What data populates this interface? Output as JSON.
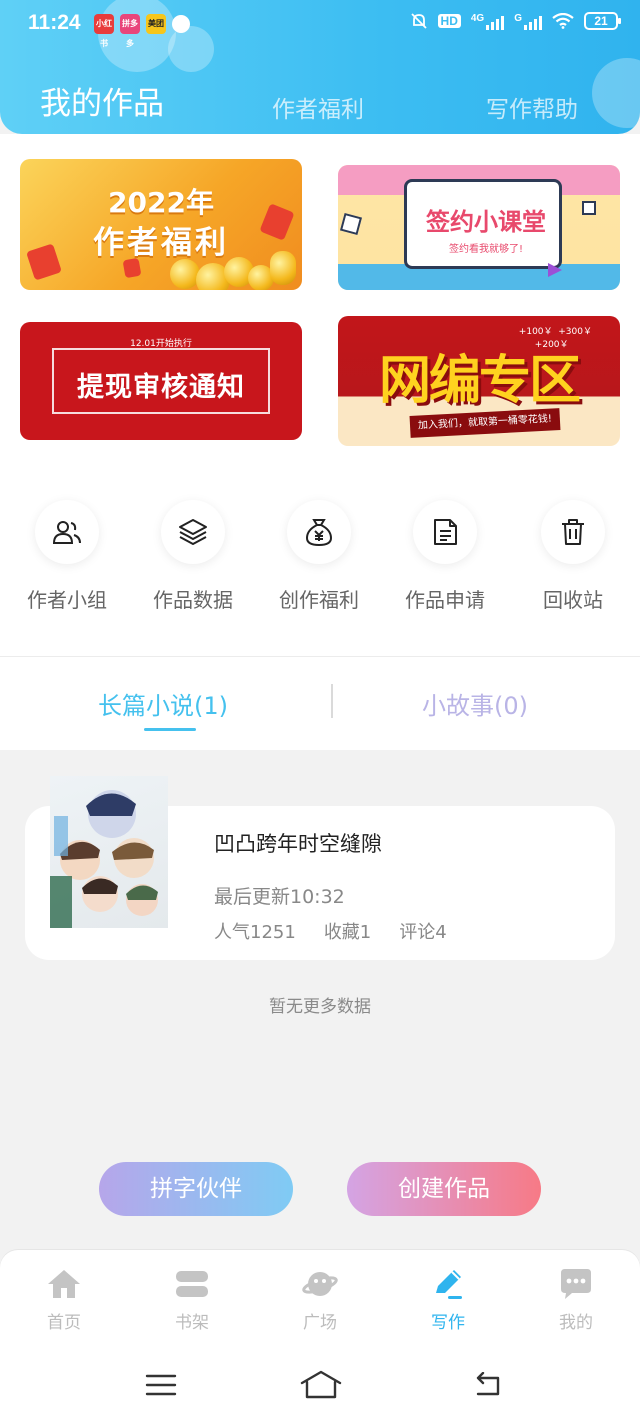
{
  "status_bar": {
    "time": "11:24",
    "app_badges": [
      "小红书",
      "拼多多",
      "美团"
    ],
    "hd_label": "HD",
    "network_4g": "4G",
    "network_g": "G",
    "battery": "21"
  },
  "header": {
    "tabs": [
      {
        "label": "我的作品",
        "active": true
      },
      {
        "label": "作者福利",
        "active": false
      },
      {
        "label": "写作帮助",
        "active": false
      }
    ]
  },
  "banners": [
    {
      "line1": "2022年",
      "line2": "作者福利"
    },
    {
      "title": "签约小课堂",
      "subtitle": "签约看我就够了!"
    },
    {
      "top_text": "12.01开始执行",
      "title": "提现审核通知"
    },
    {
      "title": "网编专区",
      "subtitle": "加入我们，就取第一桶零花钱!",
      "bonus1": "+100￥",
      "bonus2": "+300￥",
      "bonus3": "+200￥"
    }
  ],
  "functions": [
    {
      "label": "作者小组",
      "icon": "users-icon"
    },
    {
      "label": "作品数据",
      "icon": "layers-icon"
    },
    {
      "label": "创作福利",
      "icon": "money-bag-icon"
    },
    {
      "label": "作品申请",
      "icon": "document-icon"
    },
    {
      "label": "回收站",
      "icon": "trash-icon"
    }
  ],
  "work_tabs": [
    {
      "label": "长篇小说(1)",
      "active": true
    },
    {
      "label": "小故事(0)",
      "active": false
    }
  ],
  "work": {
    "title": "凹凸跨年时空缝隙",
    "update": "最后更新10:32",
    "popularity": "人气1251",
    "favorites": "收藏1",
    "comments": "评论4"
  },
  "no_more_text": "暂无更多数据",
  "actions": {
    "partner": "拼字伙伴",
    "create": "创建作品"
  },
  "bottom_nav": [
    {
      "label": "首页",
      "icon": "home-icon",
      "active": false
    },
    {
      "label": "书架",
      "icon": "bookshelf-icon",
      "active": false
    },
    {
      "label": "广场",
      "icon": "planet-icon",
      "active": false
    },
    {
      "label": "写作",
      "icon": "pen-icon",
      "active": true
    },
    {
      "label": "我的",
      "icon": "chat-bubble-icon",
      "active": false
    }
  ],
  "colors": {
    "accent": "#2fb4ee",
    "header_gradient_start": "#5fd0f6",
    "header_gradient_end": "#30b3ee",
    "inactive_nav": "#bcbcbc",
    "short_story_tab": "#b9b4e6"
  }
}
